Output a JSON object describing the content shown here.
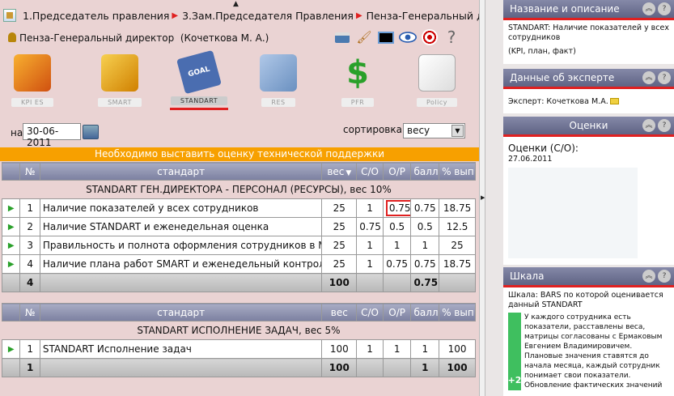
{
  "breadcrumbs": [
    "1.Председатель правления",
    "3.Зам.Председателя Правления",
    "Пенза-Генеральный директор"
  ],
  "user": {
    "name": "Пенза-Генеральный директор",
    "person": "(Кочеткова М. А.)"
  },
  "toolbar_icons": [
    "printer-icon",
    "brush-icon",
    "monitor-icon",
    "eye-icon",
    "target-icon",
    "help-icon"
  ],
  "modules": [
    {
      "label": "KPI ES",
      "icon": "kpi-icon"
    },
    {
      "label": "SMART",
      "icon": "smart-folder-icon"
    },
    {
      "label": "STANDART",
      "icon": "standart-goal-icon",
      "active": true
    },
    {
      "label": "RES",
      "icon": "resources-icon"
    },
    {
      "label": "PFR",
      "icon": "dollar-coins-icon"
    },
    {
      "label": "Policy",
      "icon": "policy-graduation-icon"
    }
  ],
  "filters": {
    "date_label": "на",
    "date_value": "30-06-2011",
    "sort_label": "сортировка:",
    "sort_value": "весу"
  },
  "alert": "Необходимо выставить оценку технической поддержки",
  "columns": {
    "num": "№",
    "standard": "стандарт",
    "weight": "вес",
    "so": "С/О",
    "op": "О/Р",
    "score": "балл",
    "pct": "% вып."
  },
  "group1": {
    "title": "STANDART ГЕН.ДИРЕКТОРА - ПЕРСОНАЛ (РЕСУРСЫ), вес 10%",
    "rows": [
      {
        "n": "1",
        "name": "Наличие показателей у всех сотрудников",
        "weight": "25",
        "so": "1",
        "op": "0.75",
        "score": "0.75",
        "pct": "18.75"
      },
      {
        "n": "2",
        "name": "Наличие STANDART и еженедельная оценка",
        "weight": "25",
        "so": "0.75",
        "op": "0.5",
        "score": "0.5",
        "pct": "12.5"
      },
      {
        "n": "3",
        "name": "Правильность и полнота оформления сотрудников в МВО",
        "weight": "25",
        "so": "1",
        "op": "1",
        "score": "1",
        "pct": "25"
      },
      {
        "n": "4",
        "name": "Наличие плана работ SMART и еженедельный контроль",
        "weight": "25",
        "so": "1",
        "op": "0.75",
        "score": "0.75",
        "pct": "18.75"
      }
    ],
    "total": {
      "n": "4",
      "weight": "100",
      "score": "0.75"
    }
  },
  "group2": {
    "title": "STANDART ИСПОЛНЕНИЕ ЗАДАЧ, вес 5%",
    "rows": [
      {
        "n": "1",
        "name": "STANDART Исполнение задач",
        "weight": "100",
        "so": "1",
        "op": "1",
        "score": "1",
        "pct": "100"
      }
    ],
    "total": {
      "n": "1",
      "weight": "100",
      "score": "1",
      "pct": "100"
    }
  },
  "side": {
    "desc": {
      "title": "Название и описание",
      "line1": "STANDART: Наличие показателей у всех сотрудников",
      "line2": "(KPI, план, факт)"
    },
    "expert": {
      "title": "Данные об эксперте",
      "text": "Эксперт: Кочеткова М.А."
    },
    "ratings": {
      "title": "Оценки",
      "label": "Оценки (С/О):",
      "date": "27.06.2011"
    },
    "scale": {
      "title": "Шкала",
      "intro": "Шкала: BARS по которой оценивается данный STANDART",
      "level": "+2",
      "text": "У каждого сотрудника есть показатели, расставлены веса, матрицы согласованы с Ермаковым Евгением Владимировичем. Плановые значения ставятся до начала месяца, каждый сотрудник понимает свои показатели. Обновление фактических значений"
    }
  },
  "colors": {
    "accent_red": "#e02020",
    "alert_orange": "#f7a000",
    "header_purple": "#7c80a0",
    "scale_green": "#3fbf5f"
  }
}
